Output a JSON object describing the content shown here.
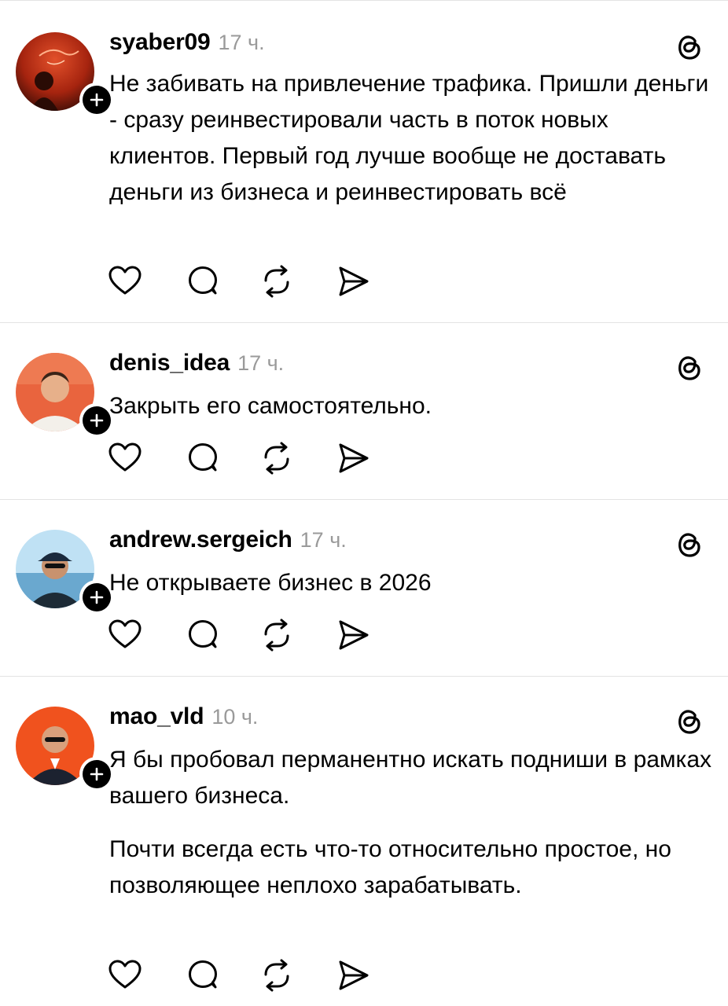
{
  "posts": [
    {
      "username": "syaber09",
      "time": "17 ч.",
      "paragraphs": [
        "Не забивать на привлечение трафика. Пришли деньги - сразу реинвестировали часть в поток новых клиентов. Первый год лучше вообще не доставать деньги из бизнеса и реинвестировать всё"
      ],
      "avatar_colors": [
        "#c2301a",
        "#3a0d06"
      ]
    },
    {
      "username": "denis_idea",
      "time": "17 ч.",
      "paragraphs": [
        "Закрыть его самостоятельно."
      ],
      "avatar_colors": [
        "#e9643e",
        "#f3f0ea"
      ]
    },
    {
      "username": "andrew.sergeich",
      "time": "17 ч.",
      "paragraphs": [
        "Не открываете бизнес в 2026"
      ],
      "avatar_colors": [
        "#bfe1f4",
        "#1d2b36"
      ]
    },
    {
      "username": "mao_vld",
      "time": "10 ч.",
      "paragraphs": [
        "Я бы пробовал перманентно искать подниши в рамках вашего бизнеса.",
        "Почти всегда есть что-то относительно простое, но позволяющее неплохо зарабатывать."
      ],
      "avatar_colors": [
        "#f0521e",
        "#1c2230"
      ]
    }
  ],
  "icons": {
    "follow": "plus-icon",
    "app": "threads-logo-icon",
    "actions": [
      "heart-icon",
      "comment-icon",
      "repost-icon",
      "share-icon"
    ]
  },
  "colors": {
    "text": "#000000",
    "muted": "#9a9a9a",
    "divider": "#e3e3e3"
  }
}
